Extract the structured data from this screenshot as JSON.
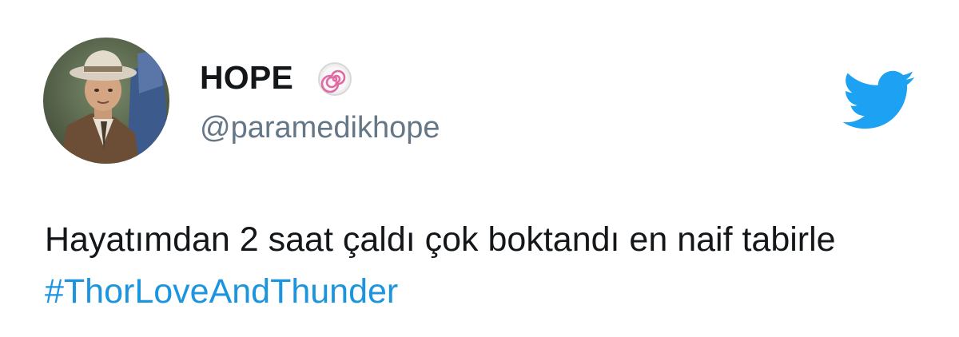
{
  "user": {
    "display_name": "HOPE",
    "handle": "@paramedikhope",
    "avatar": "avatar-photo",
    "badge_icon": "spiral-icon"
  },
  "brand": {
    "logo_icon": "twitter-bird-icon",
    "color": "#1da1f2"
  },
  "tweet": {
    "text": "Hayatımdan 2 saat çaldı çok boktandı en naif tabirle ",
    "hashtag": "#ThorLoveAndThunder",
    "hashtag_color": "#1b95e0"
  }
}
